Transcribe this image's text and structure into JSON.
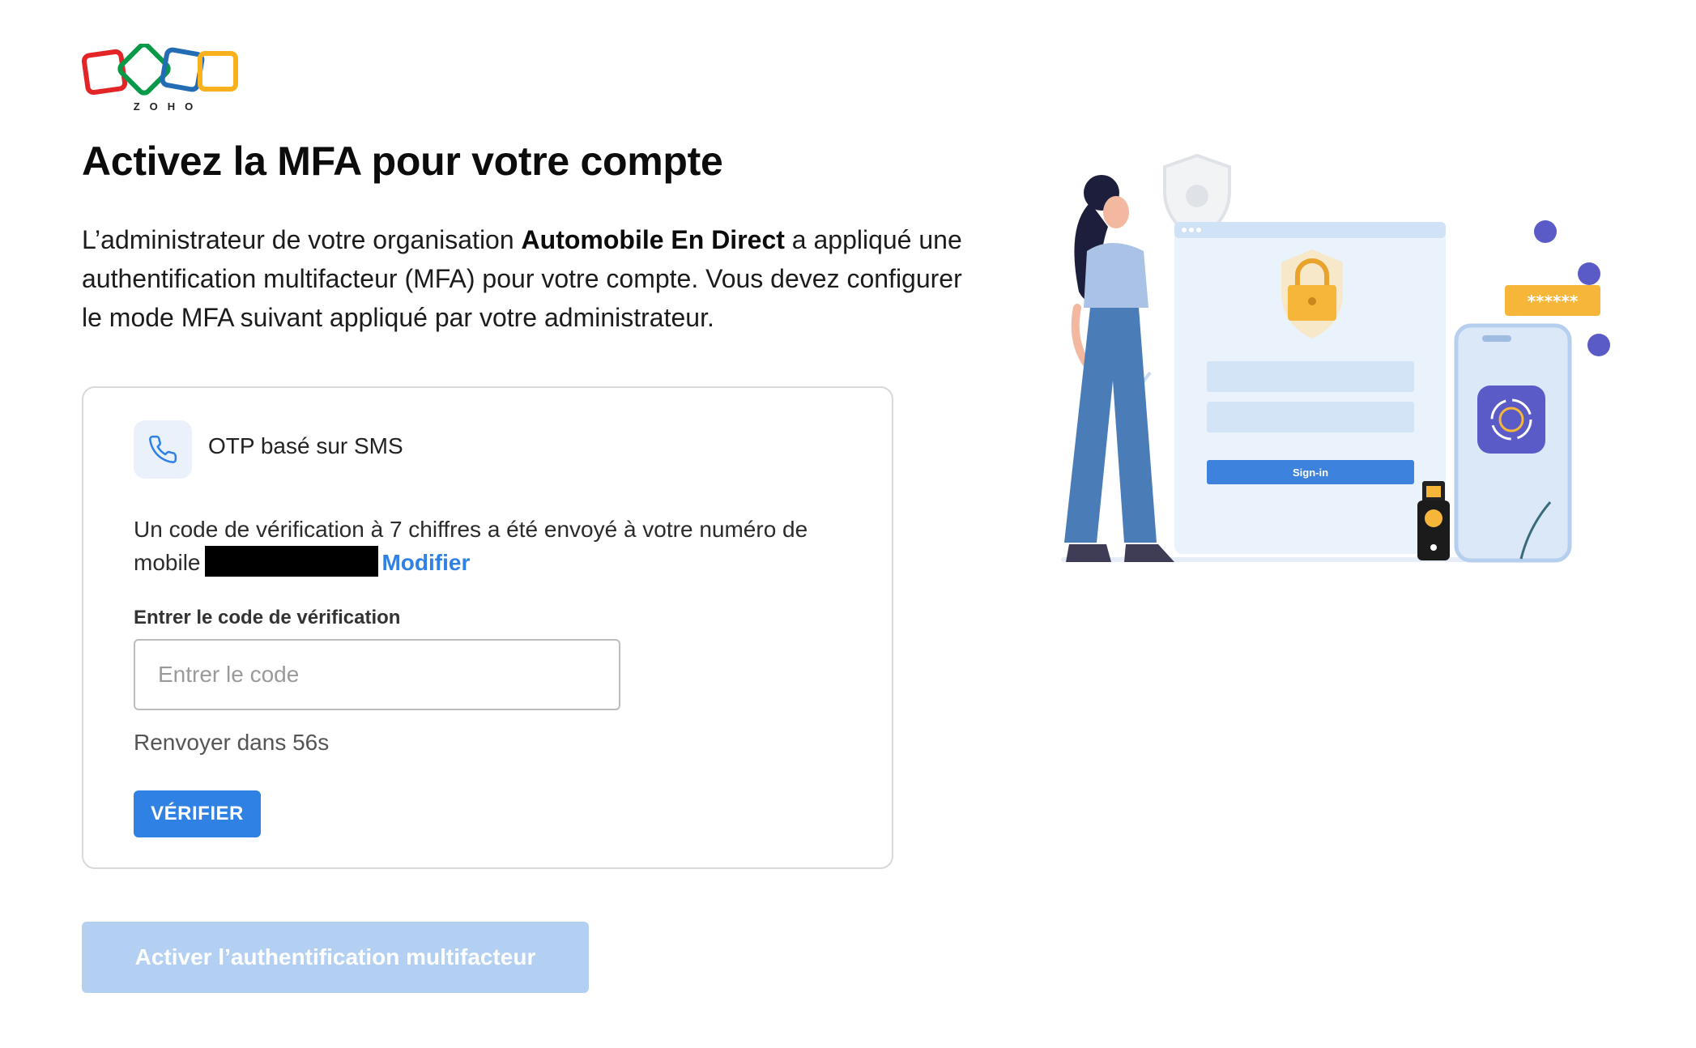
{
  "brand": {
    "logo_text": "ZOHO",
    "colors": {
      "red": "#e42527",
      "green": "#089949",
      "blue": "#226db4",
      "yellow": "#f9b21d"
    }
  },
  "page": {
    "title": "Activez la MFA pour votre compte",
    "description_prefix": "L’administrateur de votre organisation ",
    "organisation": "Automobile En Direct",
    "description_suffix": " a appliqué une authentification multifacteur (MFA) pour votre compte. Vous devez configurer le mode MFA suivant appliqué par votre administrateur."
  },
  "mfa_card": {
    "mode_icon": "phone-icon",
    "mode_label": "OTP basé sur SMS",
    "sent_text": "Un code de vérification à 7 chiffres a été envoyé à votre numéro de mobile",
    "modify_link": "Modifier",
    "field_label": "Entrer le code de vérification",
    "code_placeholder": "Entrer le code",
    "code_value": "",
    "resend_text": "Renvoyer dans 56s",
    "verify_label": "VÉRIFIER"
  },
  "footer": {
    "activate_label": "Activer l’authentification multifacteur",
    "activate_enabled": false
  },
  "illustration": {
    "signin_label": "Sign-in",
    "password_mask": "******",
    "accent_color": "#2f82e4"
  }
}
